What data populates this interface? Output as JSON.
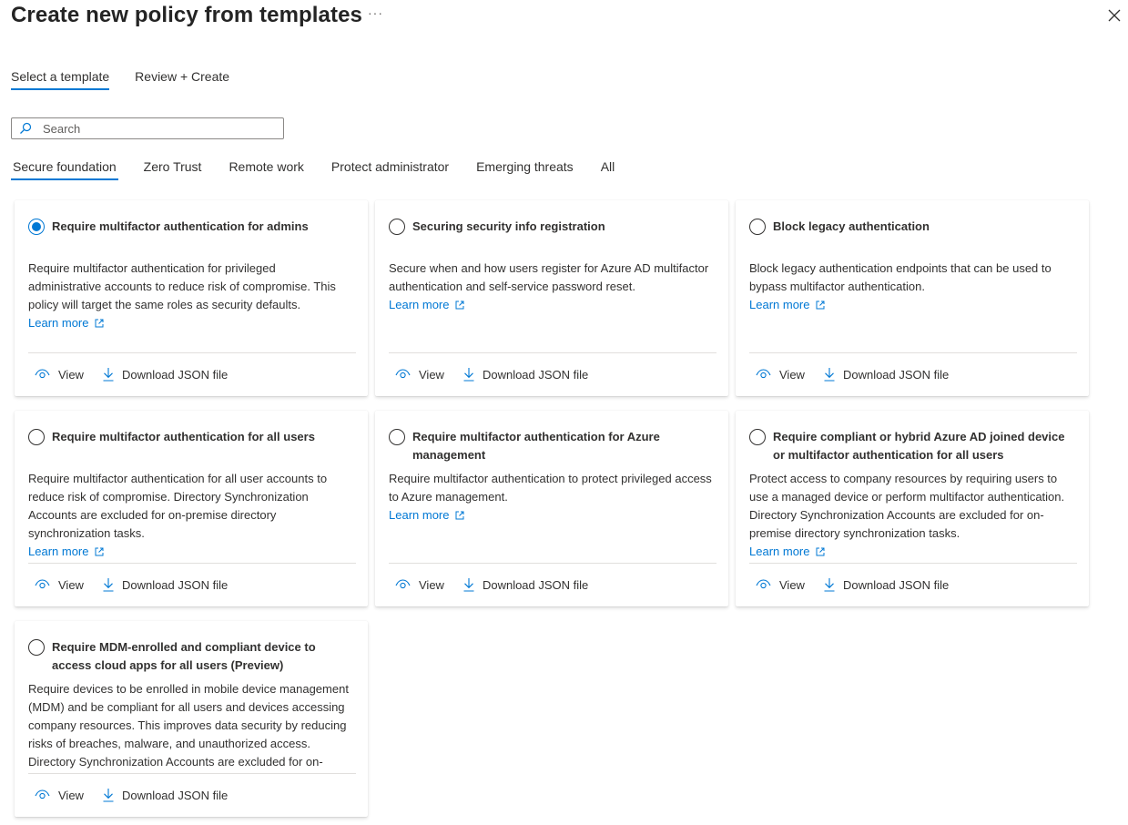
{
  "header": {
    "title": "Create new policy from templates",
    "more_glyph": "···",
    "close_icon": "close-icon"
  },
  "wizard_tabs": [
    {
      "label": "Select a template",
      "active": true
    },
    {
      "label": "Review + Create",
      "active": false
    }
  ],
  "search": {
    "placeholder": "Search",
    "value": ""
  },
  "category_tabs": [
    {
      "label": "Secure foundation",
      "active": true
    },
    {
      "label": "Zero Trust",
      "active": false
    },
    {
      "label": "Remote work",
      "active": false
    },
    {
      "label": "Protect administrator",
      "active": false
    },
    {
      "label": "Emerging threats",
      "active": false
    },
    {
      "label": "All",
      "active": false
    }
  ],
  "card_actions": {
    "view_label": "View",
    "download_label": "Download JSON file"
  },
  "accent_color": "#0078d4",
  "templates": [
    {
      "title": "Require multifactor authentication for admins",
      "selected": true,
      "description": "Require multifactor authentication for privileged administrative accounts to reduce risk of compromise. This policy will target the same roles as security defaults.",
      "learn_more": "Learn more"
    },
    {
      "title": "Securing security info registration",
      "selected": false,
      "description": "Secure when and how users register for Azure AD multifactor authentication and self-service password reset.",
      "learn_more": "Learn more"
    },
    {
      "title": "Block legacy authentication",
      "selected": false,
      "description": "Block legacy authentication endpoints that can be used to bypass multifactor authentication.",
      "learn_more": "Learn more"
    },
    {
      "title": "Require multifactor authentication for all users",
      "selected": false,
      "description": "Require multifactor authentication for all user accounts to reduce risk of compromise. Directory Synchronization Accounts are excluded for on-premise directory synchronization tasks.",
      "learn_more": "Learn more"
    },
    {
      "title": "Require multifactor authentication for Azure management",
      "selected": false,
      "description": "Require multifactor authentication to protect privileged access to Azure management.",
      "learn_more": "Learn more"
    },
    {
      "title": "Require compliant or hybrid Azure AD joined device or multifactor authentication for all users",
      "selected": false,
      "description": "Protect access to company resources by requiring users to use a managed device or perform multifactor authentication. Directory Synchronization Accounts are excluded for on-premise directory synchronization tasks.",
      "learn_more": "Learn more"
    },
    {
      "title": "Require MDM-enrolled and compliant device to access cloud apps for all users (Preview)",
      "selected": false,
      "description": "Require devices to be enrolled in mobile device management (MDM) and be compliant for all users and devices accessing company resources. This improves data security by reducing risks of breaches, malware, and unauthorized access. Directory Synchronization Accounts are excluded for on-premise",
      "learn_more": ""
    }
  ]
}
